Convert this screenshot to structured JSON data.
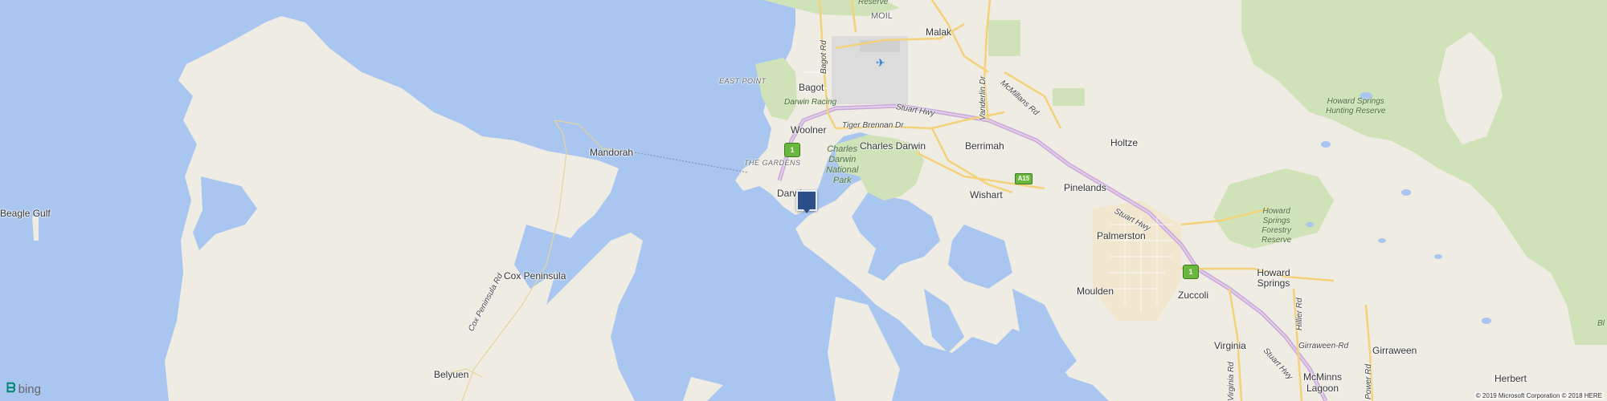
{
  "map": {
    "colors": {
      "water": "#a9c6f0",
      "land": "#efece4",
      "park": "#cfe2b8",
      "highway": "#c9a8d8",
      "major_road": "#f3d27a"
    },
    "labels": {
      "beagle_gulf": "Beagle Gulf",
      "mandorah": "Mandorah",
      "cox_peninsula": "Cox Peninsula",
      "cox_peninsula_rd": "Cox Peninsula Rd",
      "belyuen": "Belyuen",
      "east_point": "EAST POINT",
      "darwin_racing": "Darwin Racing",
      "the_gardens": "THE GARDENS",
      "darwin": "Darwin",
      "bagot": "Bagot",
      "bagot_rd": "Bagot Rd",
      "woolner": "Woolner",
      "charles_darwin": "Charles Darwin",
      "charles_darwin_np_1": "Charles",
      "charles_darwin_np_2": "Darwin",
      "charles_darwin_np_3": "National",
      "charles_darwin_np_4": "Park",
      "tiger_brennan_dr": "Tiger Brennan Dr",
      "stuart_hwy_1": "Stuart Hwy",
      "stuart_hwy_2": "Stuart Hwy",
      "stuart_hwy_3": "Stuart Hwy",
      "moil": "MOIL",
      "reserve": "Reserve",
      "malak": "Malak",
      "vanderlin_dr": "Vanderlin Dr",
      "mcmillans_rd": "McMillans Rd",
      "berrimah": "Berrimah",
      "wishart": "Wishart",
      "pinelands": "Pinelands",
      "holtze": "Holtze",
      "palmerston": "Palmerston",
      "moulden": "Moulden",
      "zuccoli": "Zuccoli",
      "howard_springs": "Howard Springs",
      "howard_springs_hunting_1": "Howard Springs",
      "howard_springs_hunting_2": "Hunting Reserve",
      "howard_springs_forestry_1": "Howard",
      "howard_springs_forestry_2": "Springs",
      "howard_springs_forestry_3": "Forestry",
      "howard_springs_forestry_4": "Reserve",
      "hillier_rd": "Hillier Rd",
      "girraween_rd": "Girraween-Rd",
      "girraween": "Girraween",
      "virginia": "Virginia",
      "virginia_rd": "Virginia Rd",
      "mcminns_lagoon_1": "McMinns",
      "mcminns_lagoon_2": "Lagoon",
      "power_rd": "Power Rd",
      "herbert": "Herbert",
      "bl": "Bl"
    },
    "shields": {
      "route1_a": "1",
      "route1_b": "1",
      "a15": "A15"
    },
    "icons": {
      "airport": "airplane-icon",
      "pin": "location-pin-icon"
    }
  },
  "branding": {
    "bing": "bing"
  },
  "copyright": "© 2019 Microsoft Corporation © 2018 HERE"
}
